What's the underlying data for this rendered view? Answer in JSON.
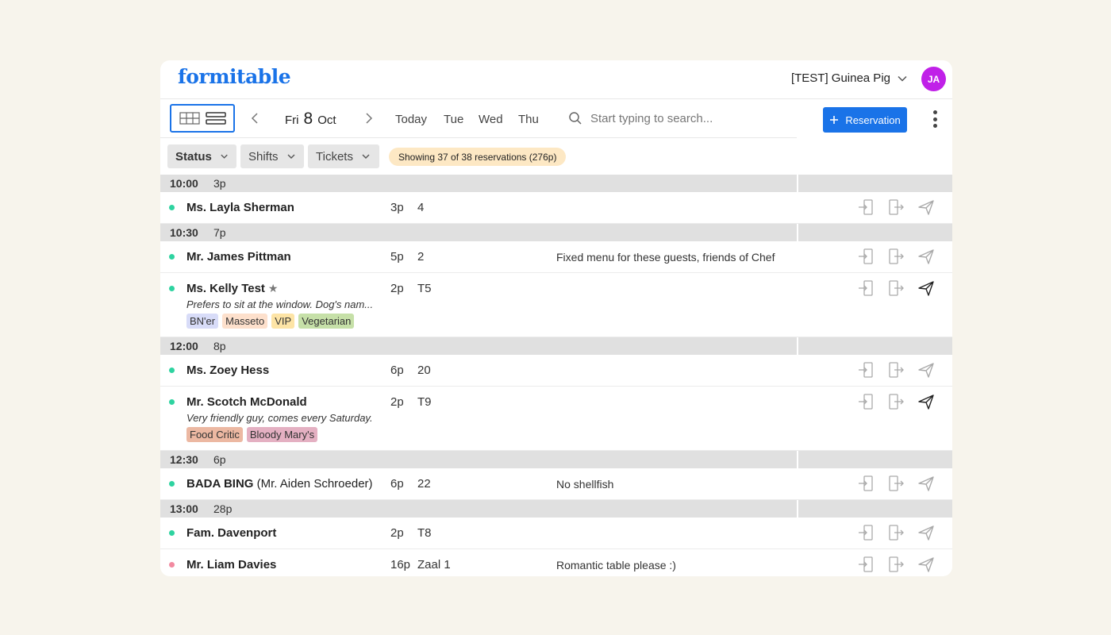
{
  "app": {
    "logo": "formitable",
    "account_name": "[TEST] Guinea Pig",
    "avatar_initials": "JA",
    "brand_color": "#1a73e8",
    "avatar_color": "#c020e8"
  },
  "toolbar": {
    "date": {
      "weekday": "Fri",
      "day": "8",
      "month": "Oct"
    },
    "quick_days": [
      "Today",
      "Tue",
      "Wed",
      "Thu"
    ],
    "search_placeholder": "Start typing to search...",
    "reservation_button": "Reservation"
  },
  "filters": {
    "status": "Status",
    "shifts": "Shifts",
    "tickets": "Tickets",
    "summary": "Showing 37 of 38 reservations (276p)"
  },
  "groups": [
    {
      "time": "10:00",
      "count": "3p",
      "rows": [
        {
          "status": "green",
          "name": "Ms. Layla Sherman",
          "pax": "3p",
          "table": "4",
          "remark": "",
          "send_active": false
        }
      ]
    },
    {
      "time": "10:30",
      "count": "7p",
      "rows": [
        {
          "status": "green",
          "name": "Mr. James Pittman",
          "pax": "5p",
          "table": "2",
          "remark": "Fixed menu for these guests, friends of Chef",
          "send_active": false
        },
        {
          "status": "green",
          "name": "Ms. Kelly Test",
          "star": true,
          "pax": "2p",
          "table": "T5",
          "remark": "",
          "note": "Prefers to sit at the window. Dog's nam...",
          "tags": [
            {
              "label": "BN'er",
              "color": "#d8dcf8"
            },
            {
              "label": "Masseto",
              "color": "#fde0cc"
            },
            {
              "label": "VIP",
              "color": "#fde4a6"
            },
            {
              "label": "Vegetarian",
              "color": "#c6e0a8"
            }
          ],
          "send_active": true
        }
      ]
    },
    {
      "time": "12:00",
      "count": "8p",
      "rows": [
        {
          "status": "green",
          "name": "Ms. Zoey Hess",
          "pax": "6p",
          "table": "20",
          "remark": "",
          "send_active": false
        },
        {
          "status": "green",
          "name": "Mr. Scotch McDonald",
          "pax": "2p",
          "table": "T9",
          "remark": "",
          "note": "Very friendly guy, comes every Saturday.",
          "tags": [
            {
              "label": "Food Critic",
              "color": "#ecb8a2"
            },
            {
              "label": "Bloody Mary's",
              "color": "#e4b0c2"
            }
          ],
          "send_active": true
        }
      ]
    },
    {
      "time": "12:30",
      "count": "6p",
      "rows": [
        {
          "status": "green",
          "name": "BADA BING",
          "name_suffix": "(Mr. Aiden Schroeder)",
          "pax": "6p",
          "table": "22",
          "remark": "No shellfish",
          "send_active": false
        }
      ]
    },
    {
      "time": "13:00",
      "count": "28p",
      "rows": [
        {
          "status": "green",
          "name": "Fam. Davenport",
          "pax": "2p",
          "table": "T8",
          "remark": "",
          "send_active": false
        },
        {
          "status": "red",
          "name": "Mr. Liam Davies",
          "pax": "16p",
          "table": "Zaal 1",
          "remark": "Romantic table please :)",
          "send_active": false
        }
      ]
    }
  ],
  "status_colors": {
    "green": "#2ed3a0",
    "red": "#f28aa0"
  },
  "icons": [
    "grid-view-icon",
    "list-view-icon",
    "chevron-left-icon",
    "chevron-right-icon",
    "search-icon",
    "plus-icon",
    "kebab-menu-icon",
    "check-in-icon",
    "check-out-icon",
    "send-icon",
    "star-icon",
    "chevron-down-icon"
  ]
}
